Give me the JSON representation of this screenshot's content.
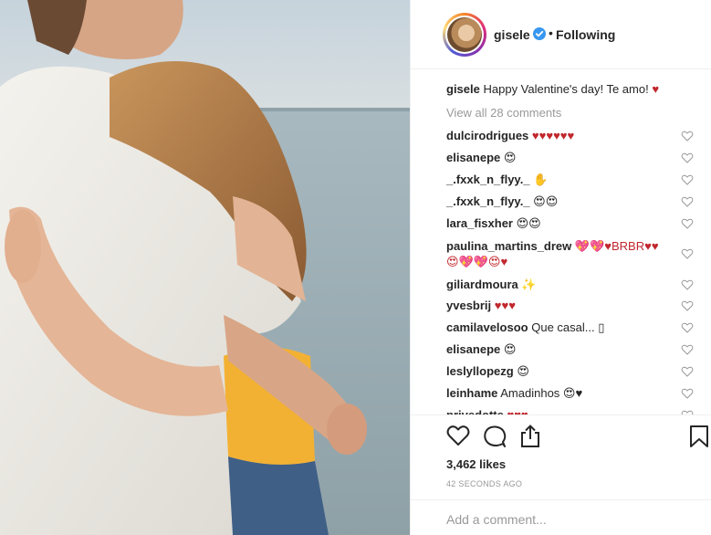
{
  "header": {
    "username": "gisele",
    "separator": "•",
    "follow_status": "Following"
  },
  "caption": {
    "username": "gisele",
    "text": "Happy Valentine's day! Te amo!",
    "emoji": "♥"
  },
  "view_all_comments": "View all 28 comments",
  "comments": [
    {
      "username": "dulcirodrigues",
      "text": "♥♥♥♥♥♥"
    },
    {
      "username": "elisanepe",
      "text": "😍"
    },
    {
      "username": "_.fxxk_n_flyy._",
      "text": "✋"
    },
    {
      "username": "_.fxxk_n_flyy._",
      "text": "😍😍"
    },
    {
      "username": "lara_fisxher",
      "text": "😍😍"
    },
    {
      "username": "paulina_martins_drew",
      "text": "💖💖♥BRBR♥♥",
      "text2": "😍💖💖😍♥"
    },
    {
      "username": "giliardmoura",
      "text": "✨"
    },
    {
      "username": "yvesbrij",
      "text": "♥♥♥"
    },
    {
      "username": "camilavelosoo",
      "text": "Que casal... ▯"
    },
    {
      "username": "elisanepe",
      "text": "😍"
    },
    {
      "username": "leslyllopezg",
      "text": "😍"
    },
    {
      "username": "leinhame",
      "text": "Amadinhos 😍♥"
    },
    {
      "username": "privedotte",
      "text": "♥♥♥"
    }
  ],
  "likes": "3,462 likes",
  "timestamp": "42 SECONDS AGO",
  "add_comment_placeholder": "Add a comment...",
  "icons": {
    "like": "heart-outline-icon",
    "comment": "speech-bubble-icon",
    "share": "share-icon",
    "save": "bookmark-icon",
    "verified": "verified-badge-icon"
  },
  "colors": {
    "verified": "#3897f0",
    "heart_emoji": "#c1272d",
    "muted_text": "#999999",
    "text": "#262626"
  }
}
